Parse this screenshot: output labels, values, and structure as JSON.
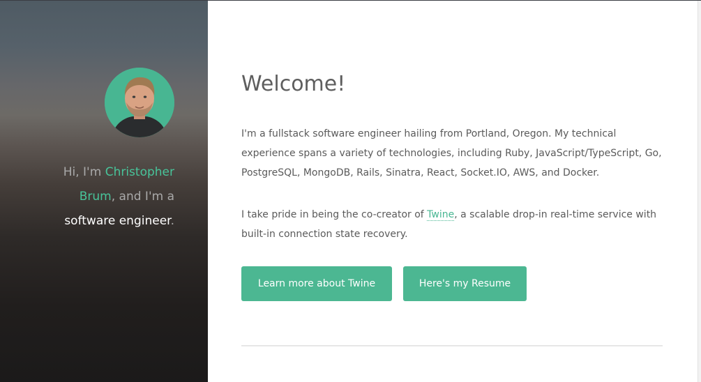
{
  "sidebar": {
    "intro_prefix": "Hi, I'm ",
    "name_first": "Christopher",
    "name_last": "Brum",
    "intro_middle": ", and I'm a",
    "role": "software engineer",
    "intro_end": "."
  },
  "main": {
    "title": "Welcome!",
    "paragraph1": "I'm a fullstack software engineer hailing from Portland, Oregon. My technical experience spans a variety of technologies, including Ruby, JavaScript/TypeScript, Go, PostgreSQL, MongoDB, Rails, Sinatra, React, Socket.IO, AWS, and Docker.",
    "paragraph2_before": "I take pride in being the co-creator of ",
    "paragraph2_link": "Twine",
    "paragraph2_after": ", a scalable drop-in real-time service with built-in connection state recovery.",
    "buttons": [
      {
        "label": "Learn more about Twine"
      },
      {
        "label": "Here's my Resume"
      }
    ]
  },
  "colors": {
    "accent": "#48b692",
    "sidebar_top": "#4f5b64",
    "sidebar_bottom": "#1b1a1a",
    "text": "#5a5a5a"
  }
}
